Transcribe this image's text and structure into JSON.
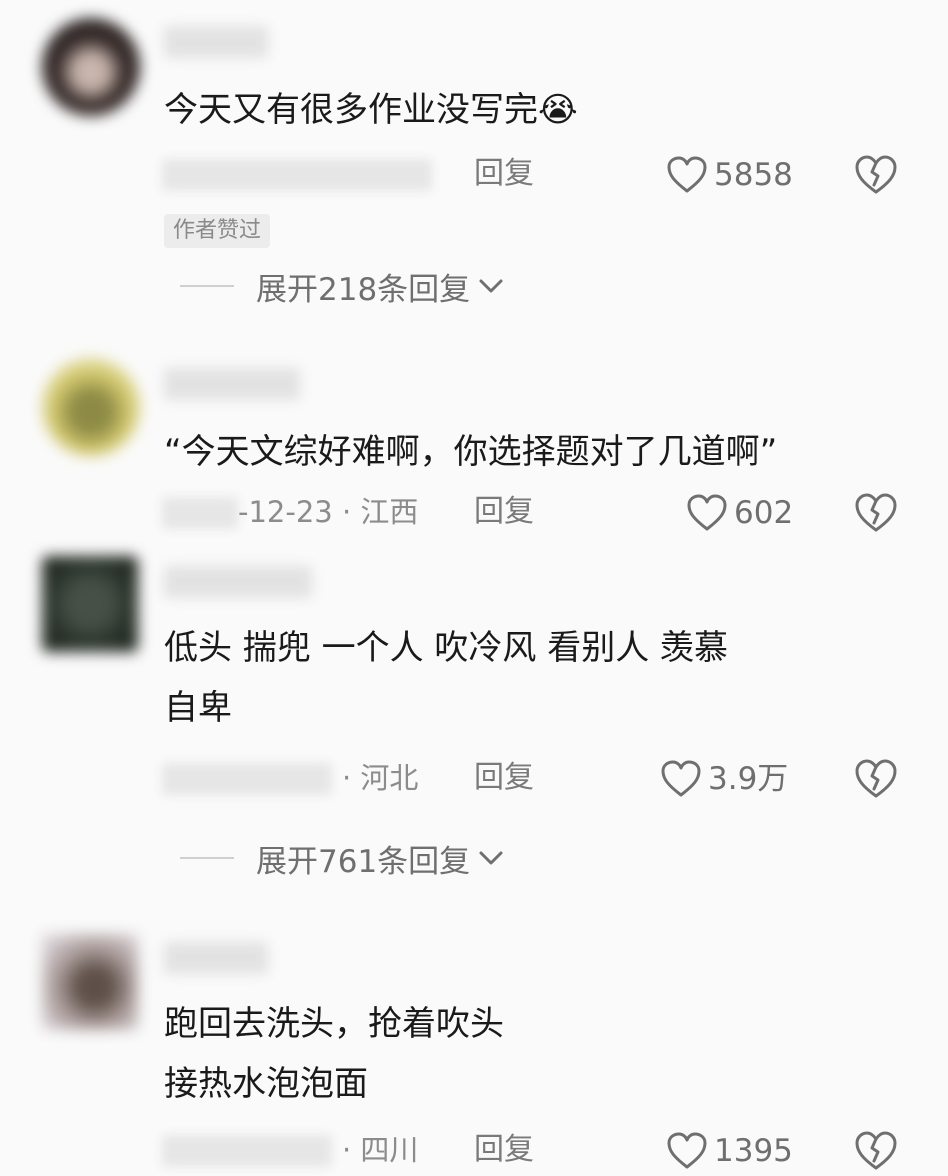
{
  "comments": [
    {
      "content_lines": [
        "今天又有很多作业没写完😭"
      ],
      "meta": "",
      "reply_label": "回复",
      "like_count": "5858",
      "badge": "作者赞过",
      "expand": "展开218条回复"
    },
    {
      "content_lines": [
        "“今天文综好难啊，你选择题对了几道啊”"
      ],
      "meta": "-12-23 · 江西",
      "reply_label": "回复",
      "like_count": "602"
    },
    {
      "content_lines": [
        "低头  揣兜  一个人  吹冷风  看别人  羡慕",
        "自卑"
      ],
      "meta": "· 河北",
      "reply_label": "回复",
      "like_count": "3.9万",
      "expand": "展开761条回复"
    },
    {
      "content_lines": [
        "跑回去洗头，抢着吹头",
        "接热水泡泡面"
      ],
      "meta": "· 四川",
      "reply_label": "回复",
      "like_count": "1395"
    }
  ],
  "icons": {
    "like": "heart-outline-icon",
    "dislike": "broken-heart-icon",
    "expand": "chevron-down-icon"
  },
  "colors": {
    "background": "#fafafa",
    "text": "#1a1a1a",
    "muted": "#8c8c8c",
    "icon": "#6f6f6f"
  }
}
